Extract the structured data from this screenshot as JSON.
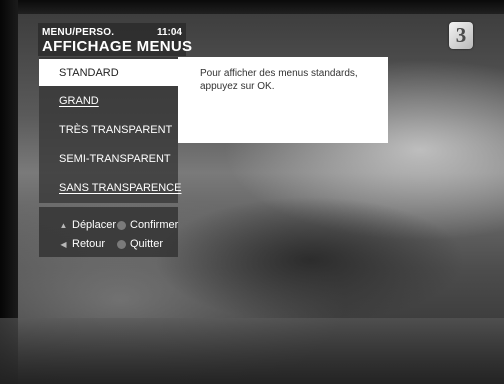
{
  "header": {
    "breadcrumb": "MENU/PERSO.",
    "time": "11:04",
    "title": "AFFICHAGE MENUS"
  },
  "channel_logo": {
    "text": "3",
    "icon": "france-3-logo"
  },
  "menu": {
    "items": [
      {
        "label": "STANDARD",
        "selected": true,
        "underlined": false
      },
      {
        "label": "GRAND",
        "selected": false,
        "underlined": true
      },
      {
        "label": "TRÈS TRANSPARENT",
        "selected": false,
        "underlined": false
      },
      {
        "label": "SEMI-TRANSPARENT",
        "selected": false,
        "underlined": false
      },
      {
        "label": "SANS TRANSPARENCE",
        "selected": false,
        "underlined": true
      }
    ]
  },
  "info": {
    "text": "Pour afficher des menus standards, appuyez sur OK."
  },
  "legend": {
    "move": {
      "label": "Déplacer",
      "icon": "up-down-arrows-icon"
    },
    "confirm": {
      "label": "Confirmer",
      "icon": "ok-button-icon"
    },
    "back": {
      "label": "Retour",
      "icon": "left-arrow-icon"
    },
    "quit": {
      "label": "Quitter",
      "icon": "menu-button-icon"
    }
  },
  "colors": {
    "panel_bg": "#373737",
    "selected_bg": "#ffffff",
    "text_light": "#ffffff",
    "text_dark": "#222222"
  }
}
